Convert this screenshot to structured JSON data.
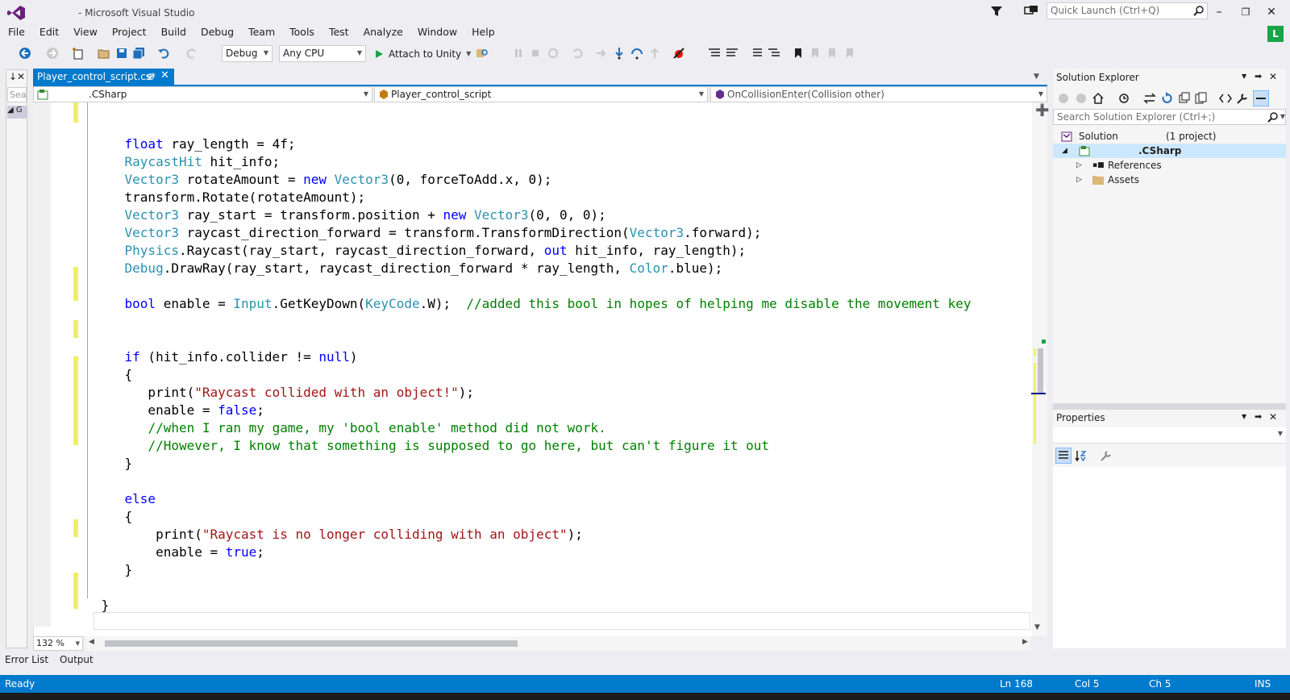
{
  "window": {
    "title": "- Microsoft Visual Studio",
    "quick_launch_placeholder": "Quick Launch (Ctrl+Q)",
    "user_initial": "L",
    "accent": "#007acc"
  },
  "menu": [
    "File",
    "Edit",
    "View",
    "Project",
    "Build",
    "Debug",
    "Team",
    "Tools",
    "Test",
    "Analyze",
    "Window",
    "Help"
  ],
  "toolbar": {
    "configuration": "Debug",
    "platform": "Any CPU",
    "attach_label": "Attach to Unity"
  },
  "toolbox": {
    "search_placeholder": "Sear",
    "item_label": "G"
  },
  "document_tab": {
    "label": "Player_control_script.cs*"
  },
  "navbar": {
    "project": ".CSharp",
    "class": "Player_control_script",
    "member": "OnCollisionEnter(Collision other)"
  },
  "zoom": "132 %",
  "code_lines": [
    [],
    [
      {
        "t": "    "
      },
      {
        "t": "float",
        "c": "kw"
      },
      {
        "t": " ray_length = 4f;"
      }
    ],
    [
      {
        "t": "    "
      },
      {
        "t": "RaycastHit",
        "c": "ty"
      },
      {
        "t": " hit_info;"
      }
    ],
    [
      {
        "t": "    "
      },
      {
        "t": "Vector3",
        "c": "ty"
      },
      {
        "t": " rotateAmount = "
      },
      {
        "t": "new",
        "c": "kw"
      },
      {
        "t": " "
      },
      {
        "t": "Vector3",
        "c": "ty"
      },
      {
        "t": "(0, forceToAdd.x, 0);"
      }
    ],
    [
      {
        "t": "    transform.Rotate(rotateAmount);"
      }
    ],
    [
      {
        "t": "    "
      },
      {
        "t": "Vector3",
        "c": "ty"
      },
      {
        "t": " ray_start = transform.position + "
      },
      {
        "t": "new",
        "c": "kw"
      },
      {
        "t": " "
      },
      {
        "t": "Vector3",
        "c": "ty"
      },
      {
        "t": "(0, 0, 0);"
      }
    ],
    [
      {
        "t": "    "
      },
      {
        "t": "Vector3",
        "c": "ty"
      },
      {
        "t": " raycast_direction_forward = transform.TransformDirection("
      },
      {
        "t": "Vector3",
        "c": "ty"
      },
      {
        "t": ".forward);"
      }
    ],
    [
      {
        "t": "    "
      },
      {
        "t": "Physics",
        "c": "ty"
      },
      {
        "t": ".Raycast(ray_start, raycast_direction_forward, "
      },
      {
        "t": "out",
        "c": "kw"
      },
      {
        "t": " hit_info, ray_length);"
      }
    ],
    [
      {
        "t": "    "
      },
      {
        "t": "Debug",
        "c": "ty"
      },
      {
        "t": ".DrawRay(ray_start, raycast_direction_forward * ray_length, "
      },
      {
        "t": "Color",
        "c": "ty"
      },
      {
        "t": ".blue);"
      }
    ],
    [],
    [
      {
        "t": "    "
      },
      {
        "t": "bool",
        "c": "kw"
      },
      {
        "t": " enable = "
      },
      {
        "t": "Input",
        "c": "ty"
      },
      {
        "t": ".GetKeyDown("
      },
      {
        "t": "KeyCode",
        "c": "ty"
      },
      {
        "t": ".W);  "
      },
      {
        "t": "//added this bool in hopes of helping me disable the movement key",
        "c": "cm"
      }
    ],
    [],
    [],
    [
      {
        "t": "    "
      },
      {
        "t": "if",
        "c": "kw"
      },
      {
        "t": " (hit_info.collider != "
      },
      {
        "t": "null",
        "c": "kw"
      },
      {
        "t": ")"
      }
    ],
    [
      {
        "t": "    {"
      }
    ],
    [
      {
        "t": "       print("
      },
      {
        "t": "\"Raycast collided with an object!\"",
        "c": "st"
      },
      {
        "t": ");"
      }
    ],
    [
      {
        "t": "       enable = "
      },
      {
        "t": "false",
        "c": "kw"
      },
      {
        "t": ";"
      }
    ],
    [
      {
        "t": "       "
      },
      {
        "t": "//when I ran my game, my 'bool enable' method did not work.",
        "c": "cm"
      }
    ],
    [
      {
        "t": "       "
      },
      {
        "t": "//However, I know that something is supposed to go here, but can't figure it out",
        "c": "cm"
      }
    ],
    [
      {
        "t": "    }"
      }
    ],
    [],
    [
      {
        "t": "    "
      },
      {
        "t": "else",
        "c": "kw"
      }
    ],
    [
      {
        "t": "    {"
      }
    ],
    [
      {
        "t": "        print("
      },
      {
        "t": "\"Raycast is no longer colliding with an object\"",
        "c": "st"
      },
      {
        "t": ");"
      }
    ],
    [
      {
        "t": "        enable = "
      },
      {
        "t": "true",
        "c": "kw"
      },
      {
        "t": ";"
      }
    ],
    [
      {
        "t": "    }"
      }
    ],
    [],
    [
      {
        "t": " }"
      }
    ]
  ],
  "solution_explorer": {
    "title": "Solution Explorer",
    "search_placeholder": "Search Solution Explorer (Ctrl+;)",
    "solution_label": "Solution",
    "solution_detail": "(1 project)",
    "project_label": ".CSharp",
    "children": [
      "References",
      "Assets"
    ]
  },
  "properties": {
    "title": "Properties"
  },
  "bottom_tabs": [
    "Error List",
    "Output"
  ],
  "status": {
    "ready": "Ready",
    "line": "Ln 168",
    "col": "Col 5",
    "ch": "Ch 5",
    "mode": "INS"
  }
}
